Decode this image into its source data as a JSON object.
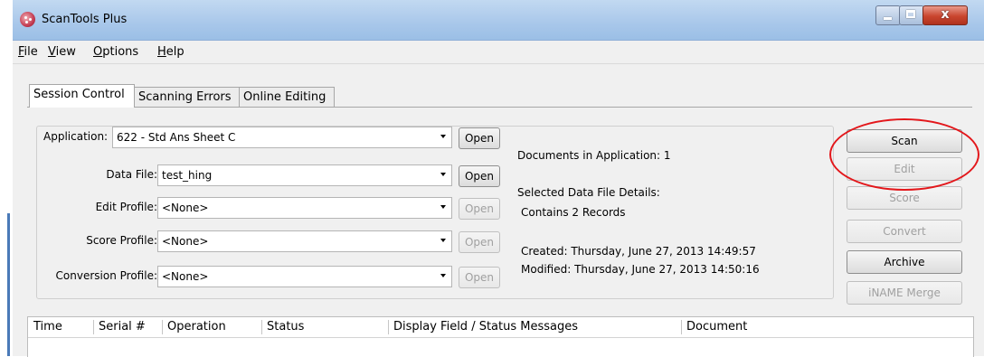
{
  "window": {
    "title": "ScanTools Plus",
    "close_glyph": "x"
  },
  "menu": [
    "File",
    "View",
    "Options",
    "Help"
  ],
  "tabs": [
    {
      "label": "Session Control",
      "active": true
    },
    {
      "label": "Scanning Errors",
      "active": false
    },
    {
      "label": "Online Editing",
      "active": false
    }
  ],
  "session": {
    "application": {
      "label": "Application:",
      "value": "622 - Std Ans Sheet C",
      "open_label": "Open"
    },
    "data_file": {
      "label": "Data File:",
      "value": "test_hing",
      "open_label": "Open"
    },
    "edit_profile": {
      "label": "Edit Profile:",
      "value": "<None>",
      "open_label": "Open"
    },
    "score_profile": {
      "label": "Score Profile:",
      "value": "<None>",
      "open_label": "Open"
    },
    "conversion_profile": {
      "label": "Conversion Profile:",
      "value": "<None>",
      "open_label": "Open"
    }
  },
  "info": {
    "documents": "Documents in Application: 1",
    "details_heading": "Selected Data File Details:",
    "records": "Contains 2 Records",
    "created": "Created: Thursday, June 27, 2013 14:49:57",
    "modified": "Modified: Thursday, June 27, 2013 14:50:16"
  },
  "actions": {
    "scan": "Scan",
    "edit": "Edit",
    "score": "Score",
    "convert": "Convert",
    "archive": "Archive",
    "iname_merge": "iNAME Merge"
  },
  "log_columns": [
    "Time",
    "Serial #",
    "Operation",
    "Status",
    "Display Field / Status Messages",
    "Document"
  ],
  "colors": {
    "annotation": "#e3171b",
    "title_bar": "#a8c7ea",
    "close_button": "#c9452e"
  }
}
